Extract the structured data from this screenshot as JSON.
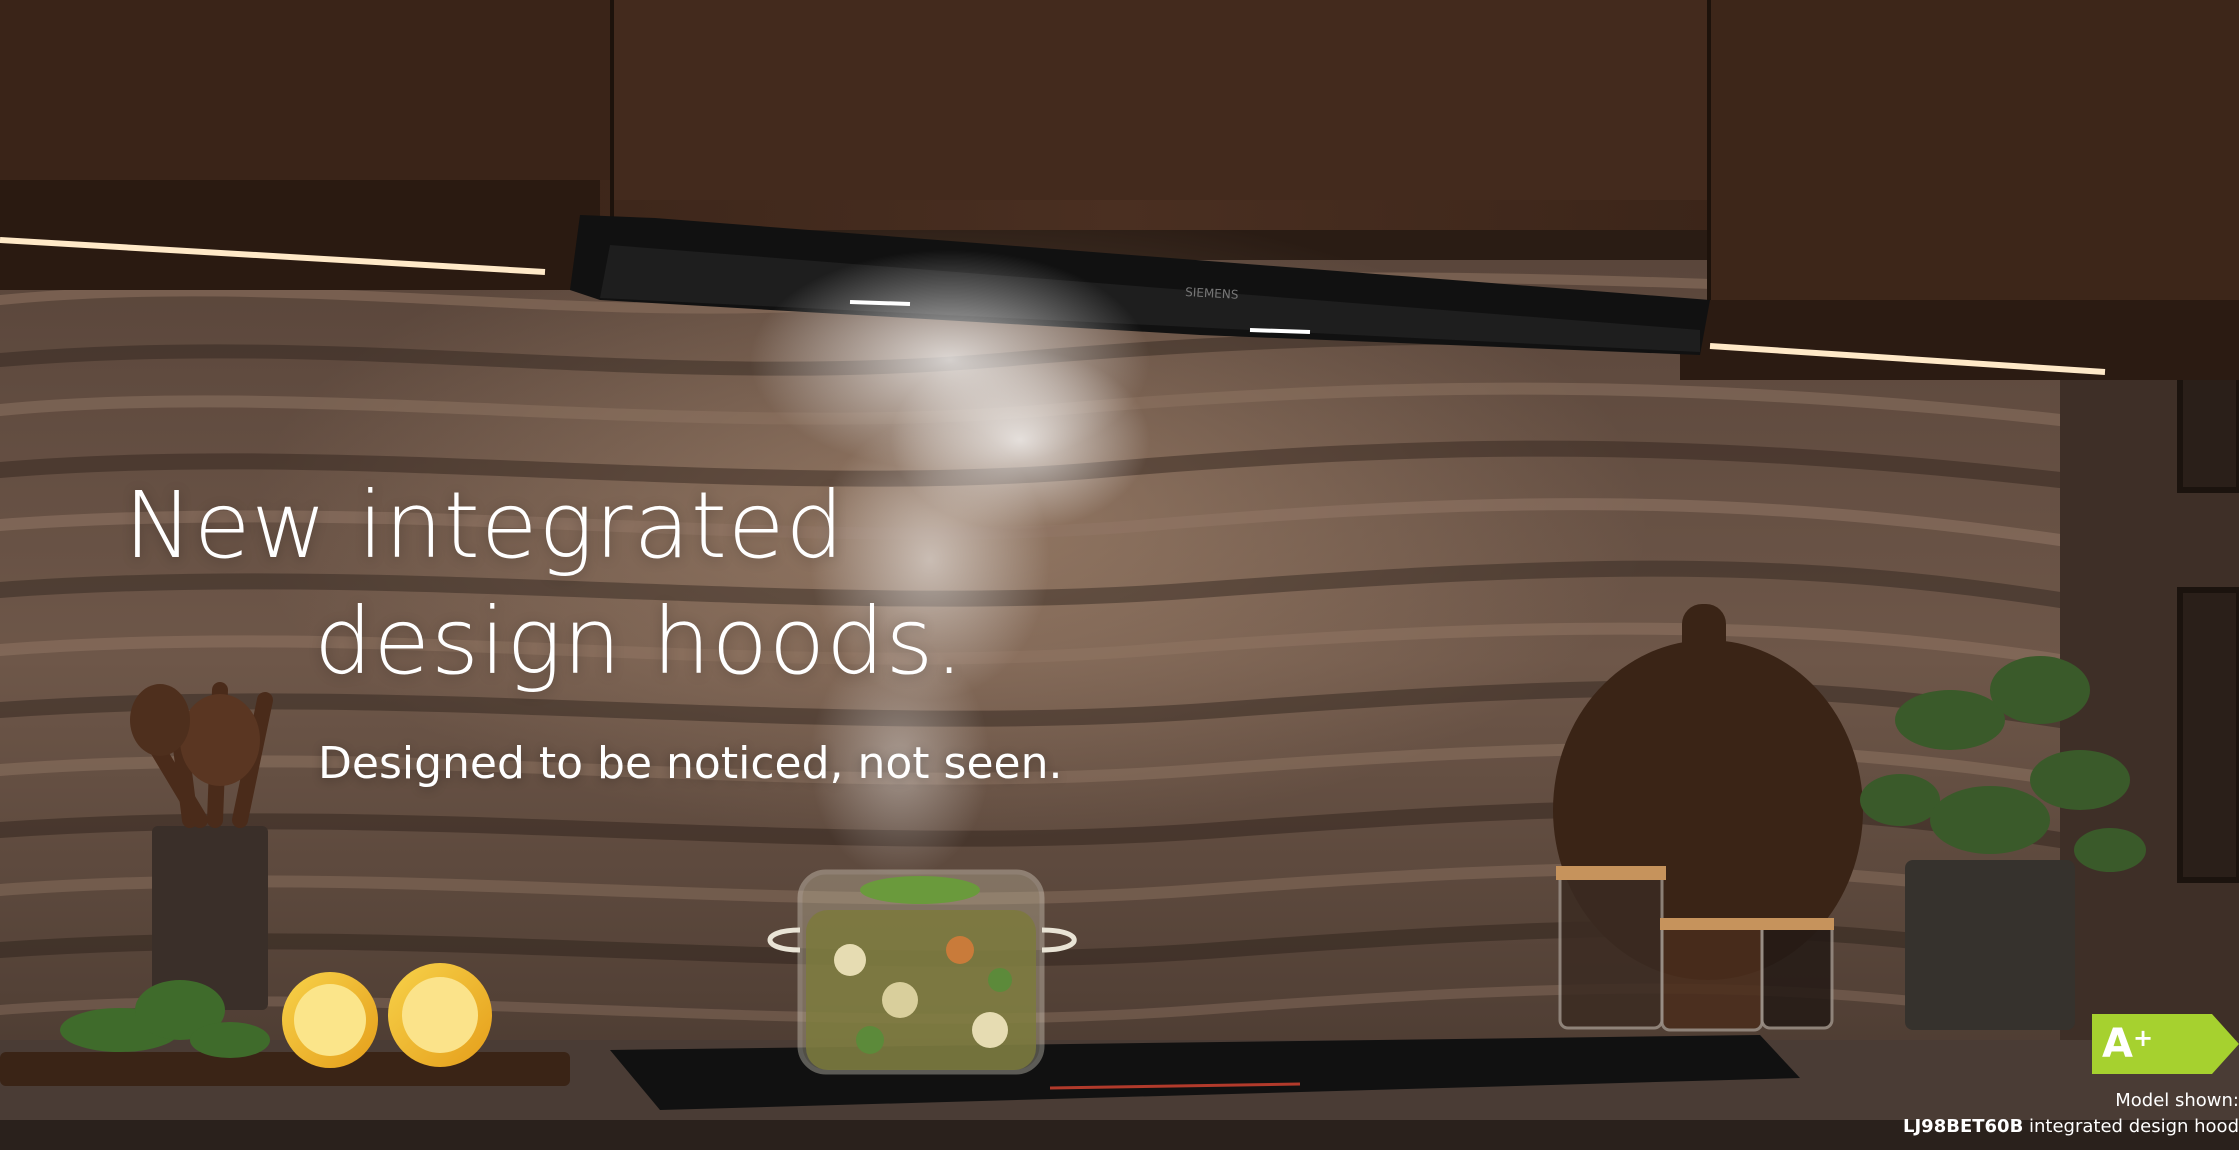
{
  "hero": {
    "headline_line1": "New integrated",
    "headline_line2": "design hoods.",
    "subline": "Designed to be noticed, not seen.",
    "hood_brand_text": "SIEMENS"
  },
  "energy_label": {
    "class_letter": "A",
    "class_suffix": "+",
    "color": "#a6d12f"
  },
  "model_note": {
    "line1": "Model shown:",
    "model_code": "LJ98BET60B",
    "model_desc": " integrated design hood"
  },
  "colors": {
    "cabinet_wood": "#3b2418",
    "backsplash": "#6b5446",
    "countertop": "#4a3c35",
    "hob": "#111111",
    "led_strip": "#ffe9c8"
  }
}
